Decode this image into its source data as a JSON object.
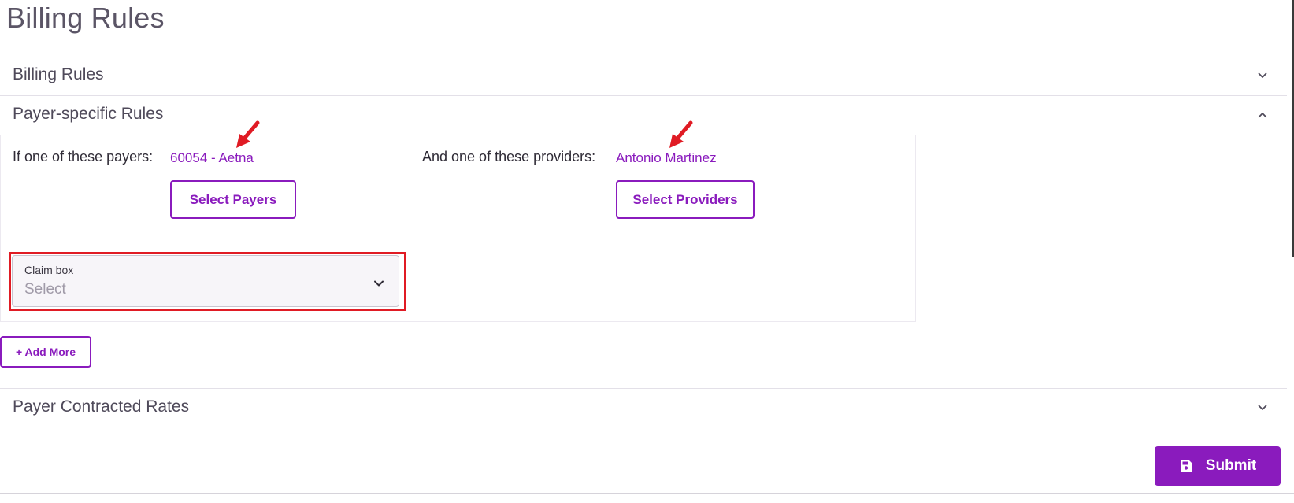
{
  "page": {
    "title": "Billing Rules"
  },
  "sections": {
    "billing_rules": {
      "title": "Billing Rules",
      "state": "collapsed"
    },
    "payer_specific_rules": {
      "title": "Payer-specific Rules",
      "state": "expanded"
    },
    "payer_contracted_rates": {
      "title": "Payer Contracted Rates",
      "state": "collapsed"
    }
  },
  "rule": {
    "payers_label": "If one of these payers:",
    "selected_payer": "60054 - Aetna",
    "select_payers_label": "Select Payers",
    "providers_label": "And one of these providers:",
    "selected_provider": "Antonio Martinez",
    "select_providers_label": "Select Providers",
    "claim_box": {
      "label": "Claim box",
      "placeholder": "Select"
    }
  },
  "actions": {
    "add_more_label": "+ Add More",
    "submit_label": "Submit"
  },
  "icons": {
    "section_toggle": "chevron-icon",
    "select_dropdown": "chevron-down-icon",
    "submit": "save-icon",
    "annotation": "red-arrow-icon"
  },
  "colors": {
    "accent": "#8a1bbd",
    "highlight": "#e01b24",
    "text": "#4f4a5a",
    "divider": "#e3e0e8"
  }
}
